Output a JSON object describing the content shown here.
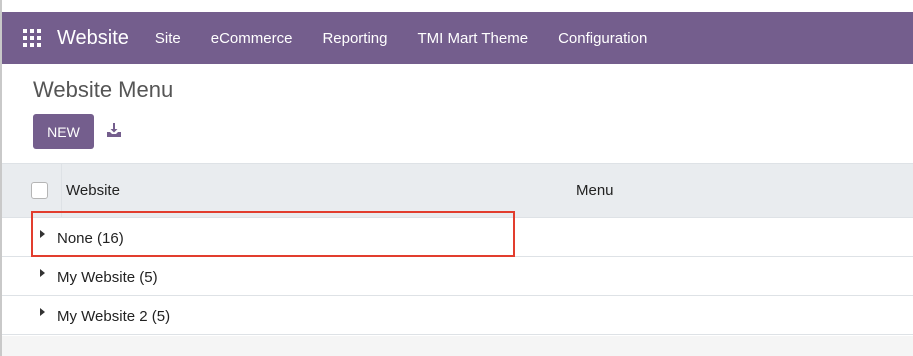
{
  "navbar": {
    "brand": "Website",
    "items": [
      "Site",
      "eCommerce",
      "Reporting",
      "TMI Mart Theme",
      "Configuration"
    ],
    "color": "#745e8d"
  },
  "page": {
    "title": "Website Menu",
    "new_label": "NEW",
    "download_icon": "download-icon"
  },
  "table": {
    "columns": [
      "Website",
      "Menu"
    ],
    "groups": [
      {
        "label": "None (16)"
      },
      {
        "label": "My Website (5)"
      },
      {
        "label": "My Website 2 (5)"
      }
    ]
  },
  "highlight_color": "#e23d2e"
}
